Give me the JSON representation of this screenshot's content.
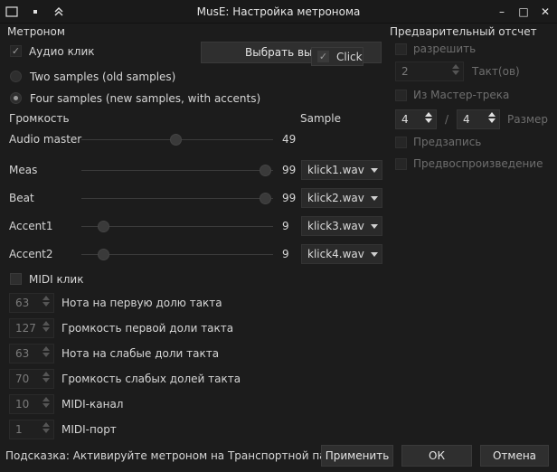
{
  "window": {
    "title": "MusE: Настройка метронома",
    "controls": {
      "minimize": "–",
      "maximize": "□",
      "close": "✕"
    }
  },
  "metronome": {
    "section_title": "Метроном",
    "audio_click": {
      "label": "Аудио клик",
      "checked": true
    },
    "select_outputs_label": "Выбрать вых",
    "click_popup": {
      "label": "Click",
      "checked": true
    },
    "two_samples": "Two samples (old samples)",
    "four_samples": "Four samples (new samples, with accents)",
    "volume_header": "Громкость",
    "sample_header": "Sample",
    "rows": [
      {
        "label": "Audio master",
        "value": "49",
        "level": 0.49,
        "sample": ""
      },
      {
        "label": "Meas",
        "value": "99",
        "level": 0.99,
        "sample": "klick1.wav"
      },
      {
        "label": "Beat",
        "value": "99",
        "level": 0.99,
        "sample": "klick2.wav"
      },
      {
        "label": "Accent1",
        "value": "9",
        "level": 0.09,
        "sample": "klick3.wav"
      },
      {
        "label": "Accent2",
        "value": "9",
        "level": 0.09,
        "sample": "klick4.wav"
      }
    ],
    "midi_click": {
      "label": "MIDI клик",
      "checked": false
    },
    "midi_rows": [
      {
        "value": "63",
        "label": "Нота на первую долю такта"
      },
      {
        "value": "127",
        "label": "Громкость первой доли такта"
      },
      {
        "value": "63",
        "label": "Нота на слабые доли такта"
      },
      {
        "value": "70",
        "label": "Громкость слабых долей такта"
      },
      {
        "value": "10",
        "label": "MIDI-канал"
      },
      {
        "value": "1",
        "label": "MIDI-порт"
      }
    ]
  },
  "precount": {
    "section_title": "Предварительный отсчет",
    "enable_label": "разрешить",
    "bars_value": "2",
    "bars_label": "Такт(ов)",
    "from_master_label": "Из Мастер-трека",
    "sig_num": "4",
    "sig_sep": "/",
    "sig_den": "4",
    "size_label": "Размер",
    "prerecord_label": "Предзапись",
    "preroll_label": "Предвоспроизведение"
  },
  "footer": {
    "hint": "Подсказка: Активируйте метроном на Транспортной панели",
    "apply_label": "Применить",
    "ok_label": "ОК",
    "cancel_label": "Отмена"
  }
}
